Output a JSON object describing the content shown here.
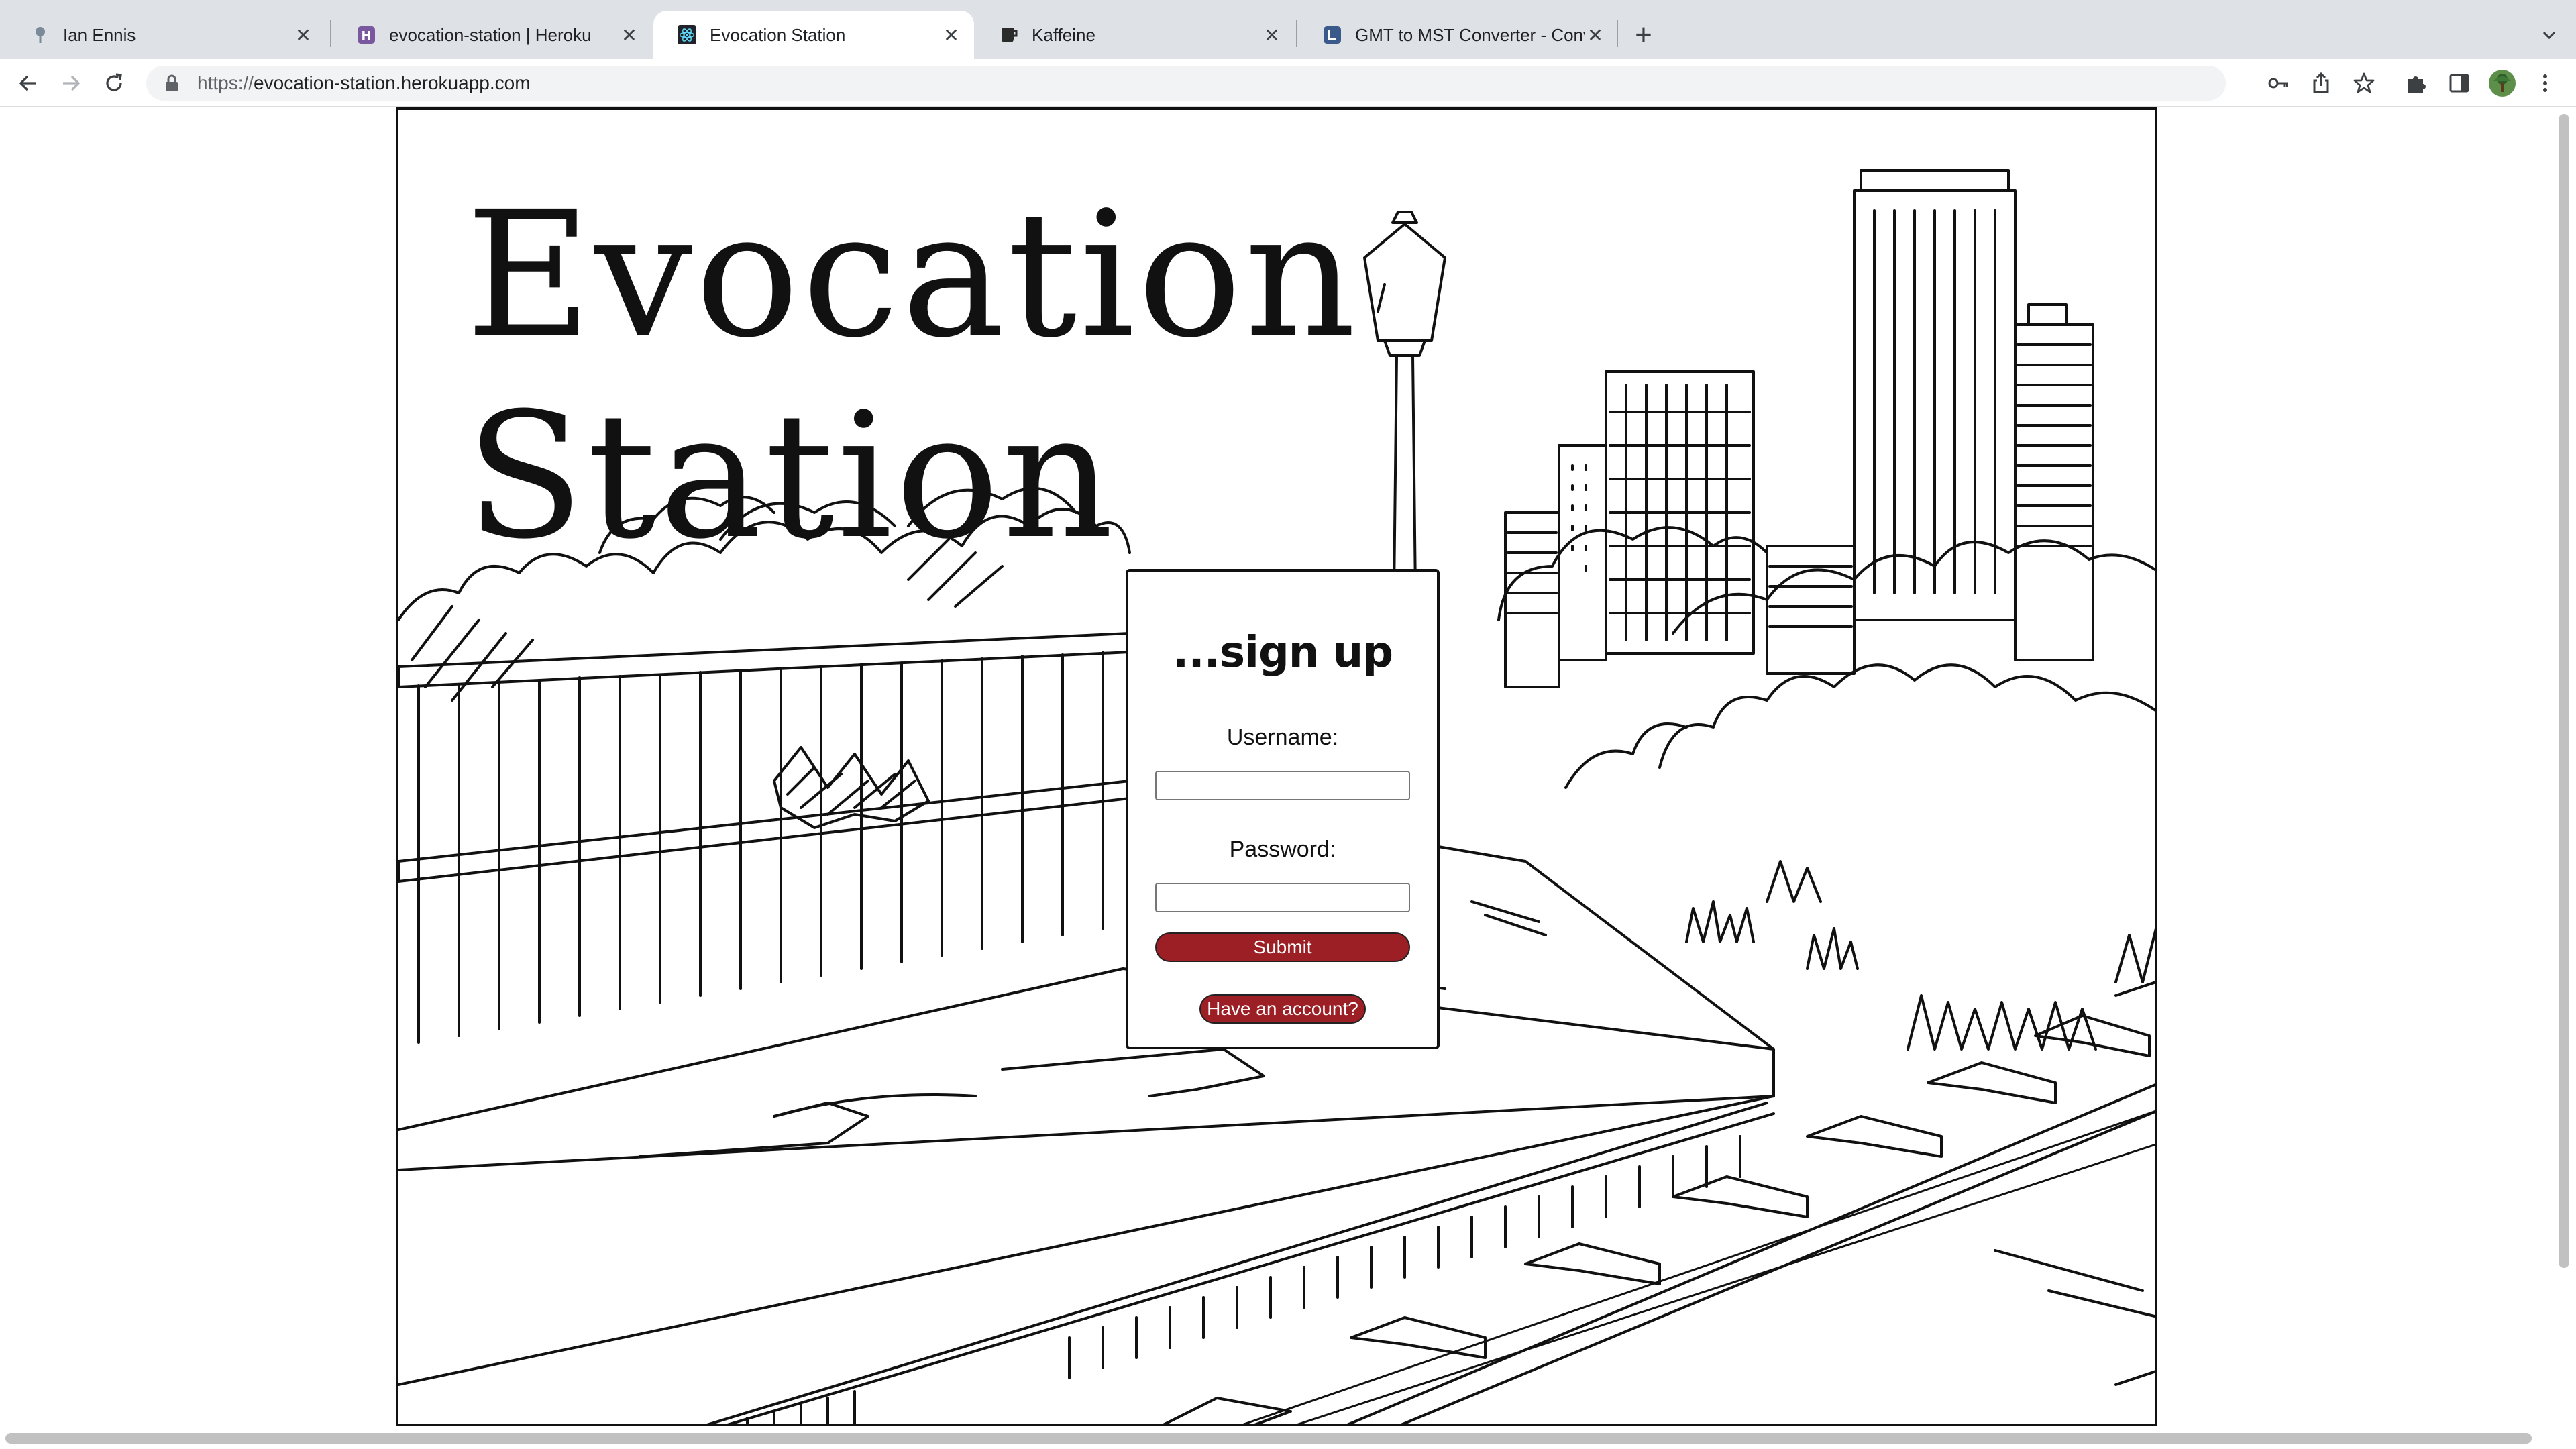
{
  "browser": {
    "tabs": [
      {
        "title": "Ian Ennis",
        "icon": "pin-icon",
        "active": false
      },
      {
        "title": "evocation-station | Heroku",
        "icon": "heroku-icon",
        "active": false
      },
      {
        "title": "Evocation Station",
        "icon": "react-icon",
        "active": true
      },
      {
        "title": "Kaffeine",
        "icon": "coffee-icon",
        "active": false
      },
      {
        "title": "GMT to MST Converter - Conv",
        "icon": "clock-icon",
        "active": false
      }
    ],
    "url": {
      "scheme": "https://",
      "host": "evocation-station.herokuapp.com"
    }
  },
  "page": {
    "title_line1": "Evocation",
    "title_line2": "Station",
    "form": {
      "heading": "...sign up",
      "username_label": "Username:",
      "username_value": "",
      "password_label": "Password:",
      "password_value": "",
      "submit_label": "Submit",
      "account_label": "Have an account?"
    }
  },
  "colors": {
    "button_bg": "#9b1f24",
    "ink": "#111111",
    "tabstrip": "#dee1e6"
  }
}
